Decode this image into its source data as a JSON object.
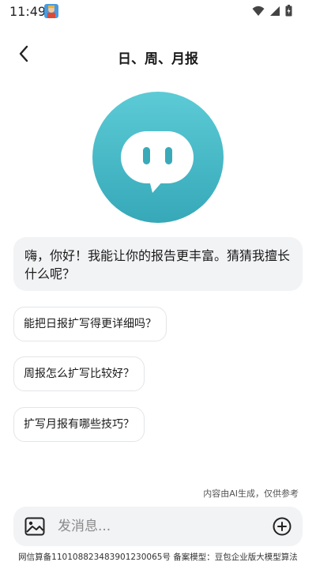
{
  "status_bar": {
    "time": "11:49",
    "icons": [
      "app-notification-icon",
      "wifi-icon",
      "signal-icon",
      "battery-icon"
    ]
  },
  "header": {
    "title": "日、周、月报",
    "back_icon": "chevron-left-icon"
  },
  "avatar": {
    "icon": "chat-bubble-face-icon",
    "color": "#3fb5c3"
  },
  "greeting": {
    "text": "嗨，你好！我能让你的报告更丰富。猜猜我擅长什么呢？"
  },
  "suggestions": [
    {
      "label": "能把日报扩写得更详细吗？"
    },
    {
      "label": "周报怎么扩写比较好？"
    },
    {
      "label": "扩写月报有哪些技巧？"
    }
  ],
  "disclaimer": "内容由AI生成，仅供参考",
  "input": {
    "placeholder": "发消息...",
    "value": "",
    "left_icon": "image-icon",
    "right_icon": "plus-circle-icon"
  },
  "footer": {
    "text": "网信算备110108823483901230065号 备案模型：豆包企业版大模型算法"
  }
}
